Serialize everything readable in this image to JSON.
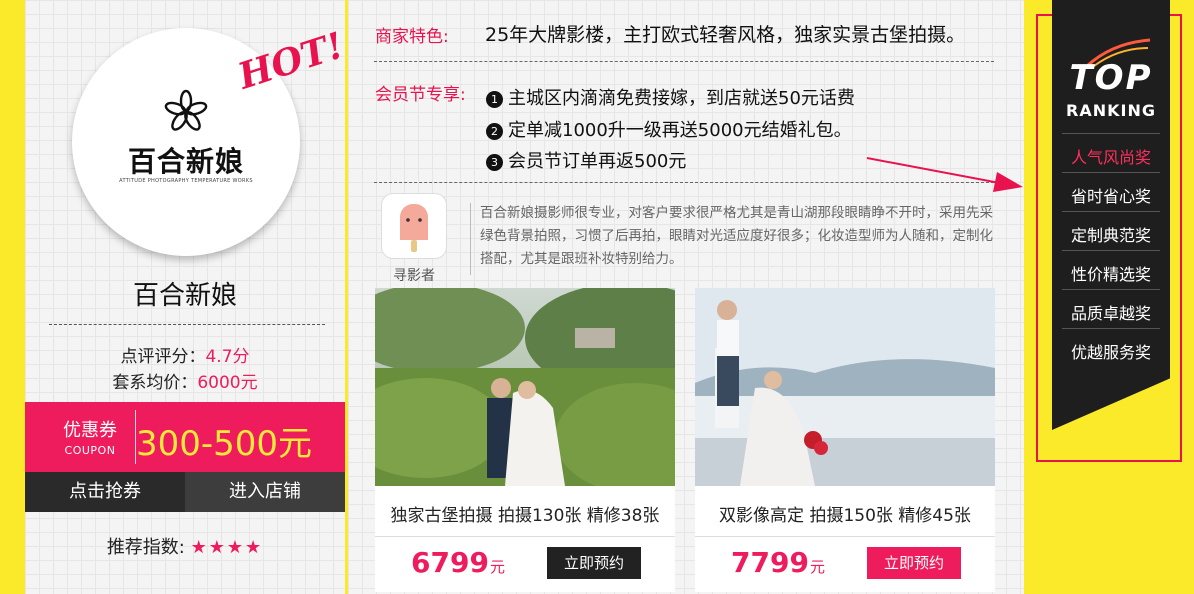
{
  "store": {
    "hot_label": "HOT!",
    "logo_text": "百合新娘",
    "logo_tagline": "ATTITUDE PHOTOGRAPHY TEMPERATURE WORKS",
    "name": "百合新娘",
    "rating_label": "点评评分：",
    "rating_value": "4.7分",
    "avg_price_label": "套系均价：",
    "avg_price_value": "6000元",
    "coupon_label": "优惠券",
    "coupon_sub": "COUPON",
    "coupon_amount": "300-500元",
    "grab_button": "点击抢券",
    "enter_button": "进入店铺",
    "recommend_label": "推荐指数:",
    "recommend_stars": "★★★★",
    "recommend_rating": 4
  },
  "features": {
    "label": "商家特色:",
    "text": "25年大牌影楼，主打欧式轻奢风格，独家实景古堡拍摄。"
  },
  "member": {
    "label": "会员节专享:",
    "items": [
      {
        "num": "1",
        "text": "主城区内滴滴免费接嫁，到店就送50元话费"
      },
      {
        "num": "2",
        "text": "定单减1000升一级再送5000元结婚礼包。"
      },
      {
        "num": "3",
        "text": "会员节订单再返500元"
      }
    ]
  },
  "review": {
    "user": "寻影者",
    "text": "百合新娘摄影师很专业，对客户要求很严格尤其是青山湖那段眼睛睁不开时，采用先采绿色背景拍照，习惯了后再拍，眼睛对光适应度好很多；化妆造型师为人随和，定制化搭配，尤其是跟班补妆特别给力。"
  },
  "packages": [
    {
      "title": "独家古堡拍摄 拍摄130张 精修38张",
      "price": "6799",
      "unit": "元",
      "button": "立即预约",
      "button_color": "#222222"
    },
    {
      "title": "双影像高定 拍摄150张 精修45张",
      "price": "7799",
      "unit": "元",
      "button": "立即预约",
      "button_color": "#ee1c5c"
    }
  ],
  "ranking": {
    "top": "TOP",
    "subtitle": "RANKING",
    "items": [
      "人气风尚奖",
      "省时省心奖",
      "定制典范奖",
      "性价精选奖",
      "品质卓越奖",
      "优越服务奖"
    ],
    "active_index": 0,
    "active_color": "#ff2f5d"
  },
  "colors": {
    "background": "#fbea2a",
    "accent": "#ee1c5c",
    "dark": "#1e1e1e"
  }
}
